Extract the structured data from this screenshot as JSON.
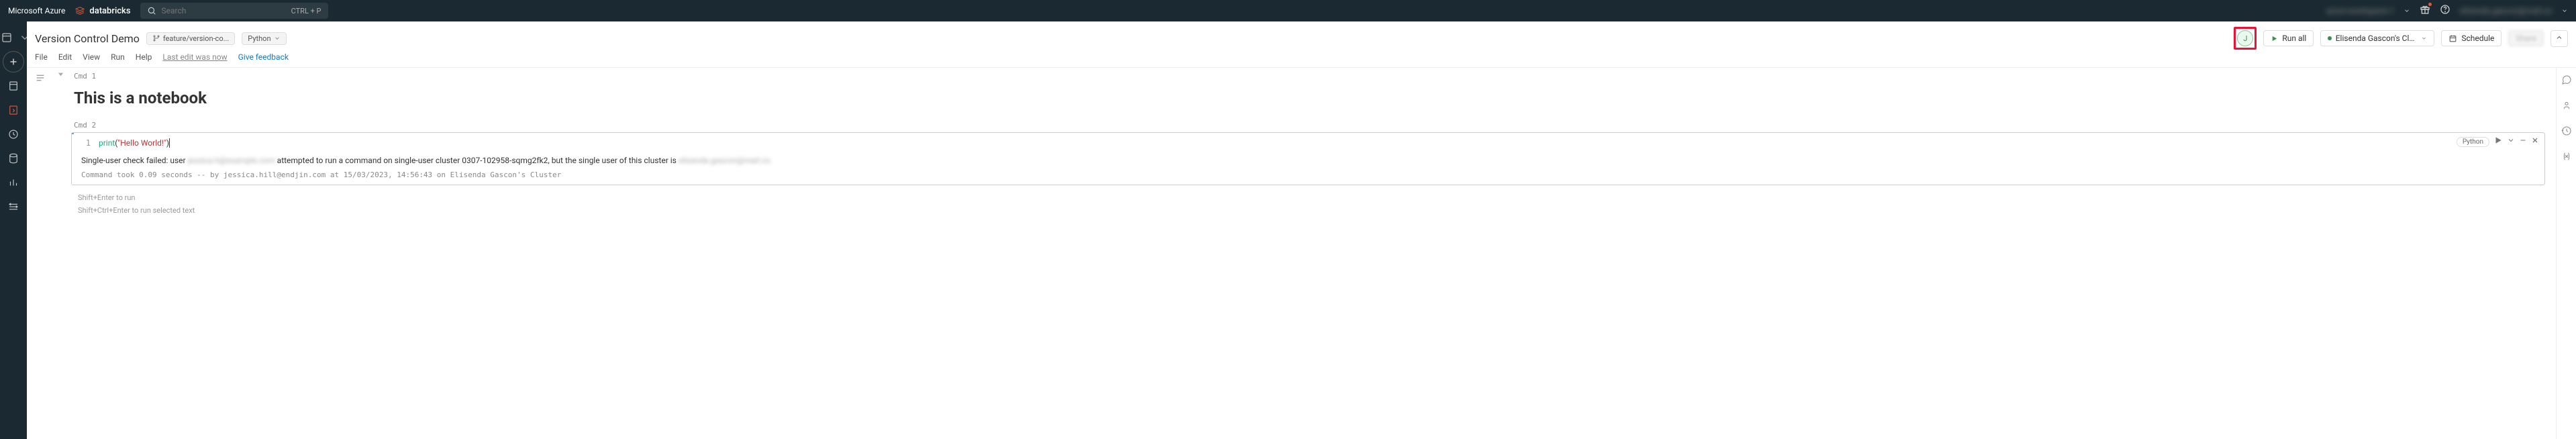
{
  "topbar": {
    "azure": "Microsoft Azure",
    "brand": "databricks",
    "search_placeholder": "Search",
    "search_kbd": "CTRL + P",
    "workspace_blur": "azure-workspace-1",
    "user_blur": "elisenda.gascon@mail.co"
  },
  "left_rail": {},
  "header": {
    "title": "Version Control Demo",
    "branch": "feature/version-co...",
    "language": "Python",
    "avatar_initial": "J",
    "run_all": "Run all",
    "cluster_name": "Elisenda Gascon's Clust...",
    "schedule": "Schedule",
    "share": "Share"
  },
  "menubar": {
    "file": "File",
    "edit": "Edit",
    "view": "View",
    "run": "Run",
    "help": "Help",
    "last_edit": "Last edit was now",
    "feedback": "Give feedback"
  },
  "cells": {
    "cmd1_label": "Cmd 1",
    "cmd2_label": "Cmd 2",
    "md_heading": "This is a notebook",
    "code_lineno": "1",
    "code_fn": "print",
    "code_paren_open": "(",
    "code_str": "\"Hello World!\"",
    "code_paren_close": ")",
    "cell_lang_tag": "Python",
    "error_prefix": "Single-user check failed: user ",
    "error_user_blur": "jessica.h@example.com",
    "error_mid": " attempted to run a command on single-user cluster 0307-102958-sqmg2fk2, but the single user of this cluster is ",
    "error_owner_blur": "elisenda.gascon@mail.co",
    "meta": "Command took 0.09 seconds -- by jessica.hill@endjin.com at 15/03/2023, 14:56:43 on Elisenda Gascon's Cluster"
  },
  "hints": {
    "h1": "Shift+Enter to run",
    "h2": "Shift+Ctrl+Enter to run selected text"
  }
}
